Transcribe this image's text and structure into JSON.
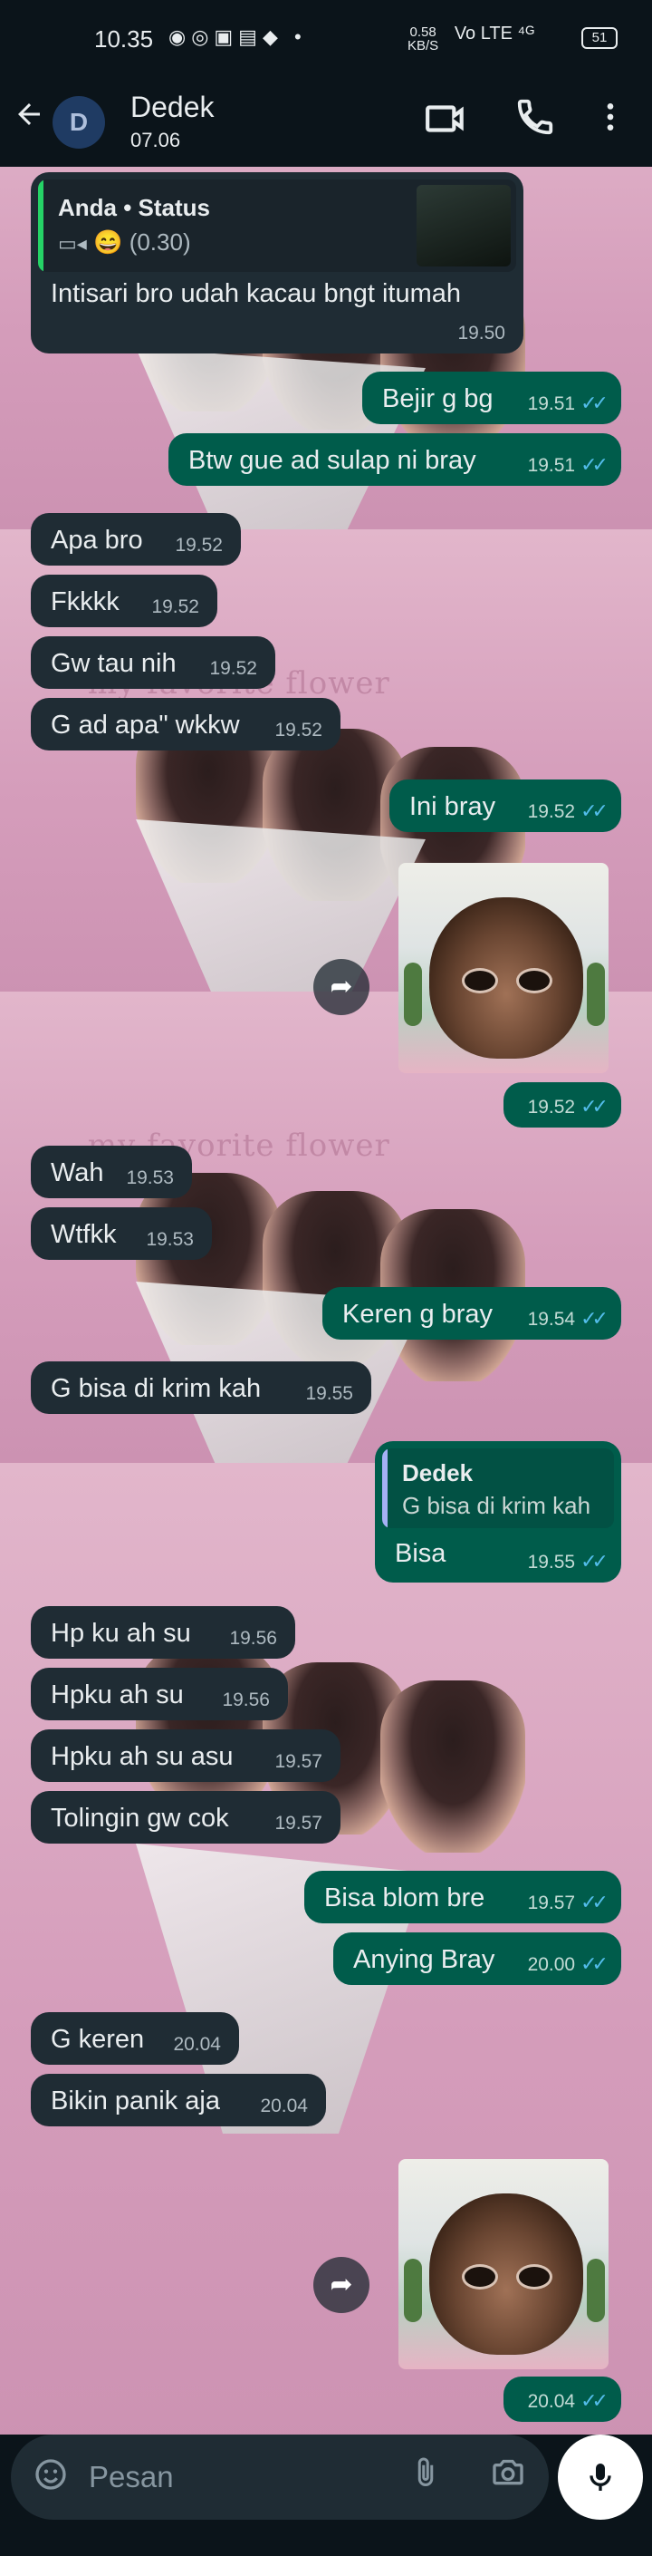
{
  "status_bar": {
    "time": "10.35",
    "speed": "0.58\nKB/S",
    "net": "Vo LTE ⁴ᴳ",
    "battery": "51"
  },
  "header": {
    "avatar_letter": "D",
    "name": "Dedek",
    "subtitle": "07.06"
  },
  "messages": [
    {
      "dir": "in",
      "text": "Intisari bro udah kacau bngt itumah",
      "time": "19.50",
      "quote": {
        "author": "Anda • Status",
        "text": "(0.30)"
      }
    },
    {
      "dir": "out",
      "text": "Bejir g bg",
      "time": "19.51"
    },
    {
      "dir": "out",
      "text": "Btw gue ad sulap ni bray",
      "time": "19.51"
    },
    {
      "dir": "in",
      "text": "Apa bro",
      "time": "19.52"
    },
    {
      "dir": "in",
      "text": "Fkkkk",
      "time": "19.52"
    },
    {
      "dir": "in",
      "text": "Gw tau nih",
      "time": "19.52"
    },
    {
      "dir": "in",
      "text": "G ad apa\" wkkw",
      "time": "19.52"
    },
    {
      "dir": "out",
      "text": "Ini bray",
      "time": "19.52"
    },
    {
      "dir": "out",
      "type": "sticker",
      "time": "19.52"
    },
    {
      "dir": "in",
      "text": "Wah",
      "time": "19.53"
    },
    {
      "dir": "in",
      "text": "Wtfkk",
      "time": "19.53"
    },
    {
      "dir": "out",
      "text": "Keren g bray",
      "time": "19.54"
    },
    {
      "dir": "in",
      "text": "G bisa di krim kah",
      "time": "19.55"
    },
    {
      "dir": "out",
      "text": "Bisa",
      "time": "19.55",
      "quote": {
        "author": "Dedek",
        "text": "G bisa di krim kah"
      }
    },
    {
      "dir": "in",
      "text": "Hp ku ah su",
      "time": "19.56"
    },
    {
      "dir": "in",
      "text": "Hpku ah su",
      "time": "19.56"
    },
    {
      "dir": "in",
      "text": "Hpku ah su asu",
      "time": "19.57"
    },
    {
      "dir": "in",
      "text": "Tolingin gw cok",
      "time": "19.57"
    },
    {
      "dir": "out",
      "text": "Bisa blom bre",
      "time": "19.57"
    },
    {
      "dir": "out",
      "text": "Anying Bray",
      "time": "20.00"
    },
    {
      "dir": "in",
      "text": "G keren",
      "time": "20.04"
    },
    {
      "dir": "in",
      "text": "Bikin panik aja",
      "time": "20.04"
    },
    {
      "dir": "out",
      "type": "sticker",
      "time": "20.04"
    }
  ],
  "wallpaper": {
    "caption": "— my favorite flower"
  },
  "composer": {
    "placeholder": "Pesan"
  },
  "colors": {
    "bg": "#0b141a",
    "incoming": "#1f2c34",
    "outgoing": "#005c4b",
    "read_tick": "#53bdeb",
    "quote_self": "#25d366",
    "quote_other": "#a5b1f5"
  },
  "icons": [
    "back-arrow-icon",
    "video-call-icon",
    "phone-call-icon",
    "more-menu-icon",
    "forward-icon",
    "emoji-icon",
    "attach-icon",
    "camera-icon",
    "mic-icon",
    "video-icon"
  ]
}
